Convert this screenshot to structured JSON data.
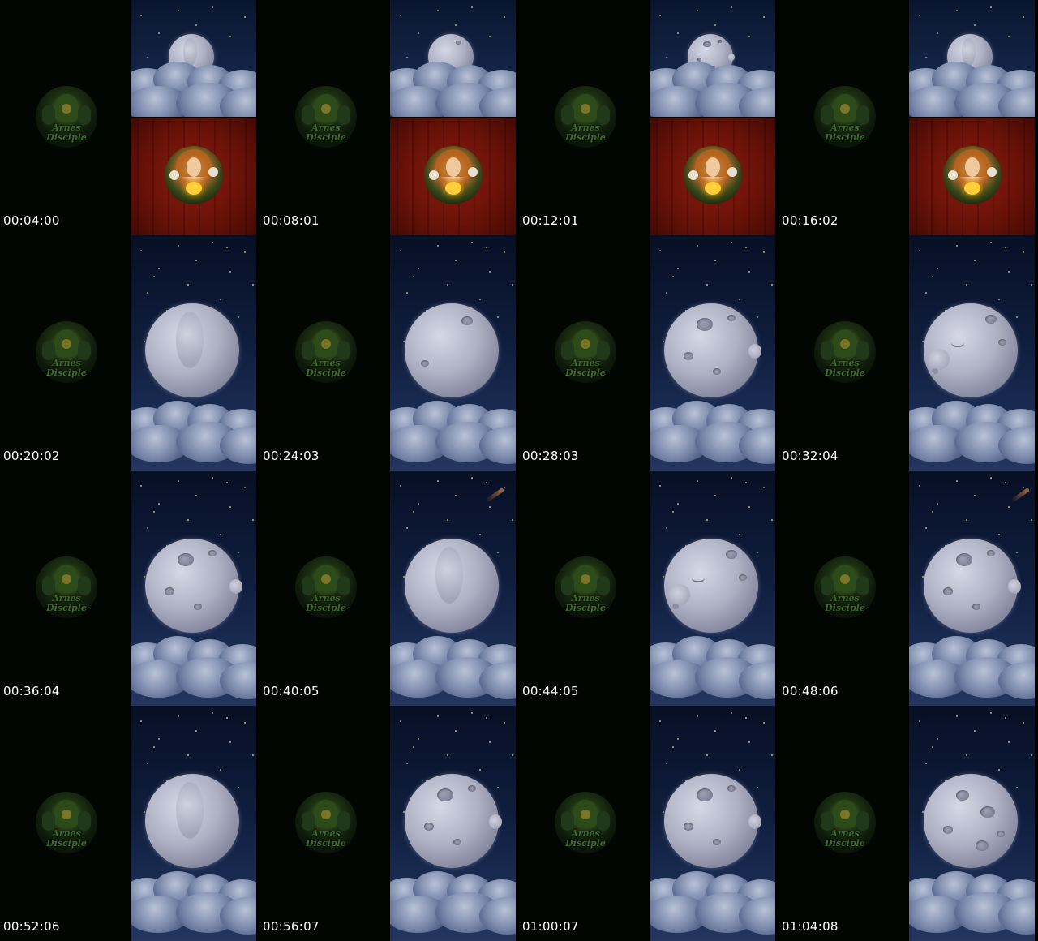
{
  "logo": {
    "line1": "Arnes",
    "line2": "Disciple"
  },
  "thumbnails": [
    {
      "time": "00:04:00",
      "scene": "split-intro",
      "moon": "back"
    },
    {
      "time": "00:08:01",
      "scene": "split-intro",
      "moon": "plain"
    },
    {
      "time": "00:12:01",
      "scene": "split-intro",
      "moon": "profile"
    },
    {
      "time": "00:16:02",
      "scene": "split-intro",
      "moon": "back"
    },
    {
      "time": "00:20:02",
      "scene": "sky",
      "moon": "back"
    },
    {
      "time": "00:24:03",
      "scene": "sky",
      "moon": "plain"
    },
    {
      "time": "00:28:03",
      "scene": "sky",
      "moon": "profile"
    },
    {
      "time": "00:32:04",
      "scene": "sky",
      "moon": "face"
    },
    {
      "time": "00:36:04",
      "scene": "sky",
      "moon": "profile"
    },
    {
      "time": "00:40:05",
      "scene": "sky",
      "moon": "back"
    },
    {
      "time": "00:44:05",
      "scene": "sky",
      "moon": "face"
    },
    {
      "time": "00:48:06",
      "scene": "sky",
      "moon": "profile"
    },
    {
      "time": "00:52:06",
      "scene": "sky",
      "moon": "back"
    },
    {
      "time": "00:56:07",
      "scene": "sky",
      "moon": "profile"
    },
    {
      "time": "01:00:07",
      "scene": "sky",
      "moon": "profile"
    },
    {
      "time": "01:04:08",
      "scene": "sky",
      "moon": "craters"
    }
  ]
}
